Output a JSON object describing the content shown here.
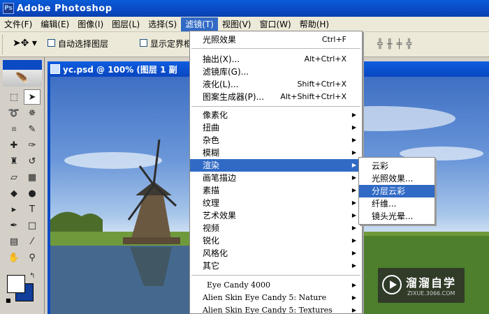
{
  "app_title": "Adobe Photoshop",
  "app_icon": "Ps",
  "menubar": [
    "文件(F)",
    "编辑(E)",
    "图像(I)",
    "图层(L)",
    "选择(S)",
    "滤镜(T)",
    "视图(V)",
    "窗口(W)",
    "帮助(H)"
  ],
  "options": {
    "auto_select": "自动选择图层",
    "show_bounds": "显示定界框"
  },
  "document": {
    "title": "yc.psd @ 100% (图层 1 副"
  },
  "filter_menu": {
    "last_filter": {
      "label": "光照效果",
      "shortcut": "Ctrl+F"
    },
    "group1": [
      {
        "label": "抽出(X)...",
        "shortcut": "Alt+Ctrl+X"
      },
      {
        "label": "滤镜库(G)...",
        "shortcut": ""
      },
      {
        "label": "液化(L)...",
        "shortcut": "Shift+Ctrl+X"
      },
      {
        "label": "图案生成器(P)...",
        "shortcut": "Alt+Shift+Ctrl+X"
      }
    ],
    "submenus": [
      "像素化",
      "扭曲",
      "杂色",
      "模糊",
      "渲染",
      "画笔描边",
      "素描",
      "纹理",
      "艺术效果",
      "视频",
      "锐化",
      "风格化",
      "其它"
    ],
    "plugins": [
      "Eye Candy 4000",
      "Alien Skin Eye Candy 5: Nature",
      "Alien Skin Eye Candy 5: Textures"
    ]
  },
  "render_submenu": [
    "云彩",
    "光照效果...",
    "分层云彩",
    "纤维...",
    "镜头光晕..."
  ],
  "watermark": {
    "brand": "溜溜自学",
    "url": "ZIXUE.3066.COM"
  },
  "colors": {
    "fg": "#ffffff",
    "bg": "#123e9a",
    "highlight": "#316ac5"
  }
}
